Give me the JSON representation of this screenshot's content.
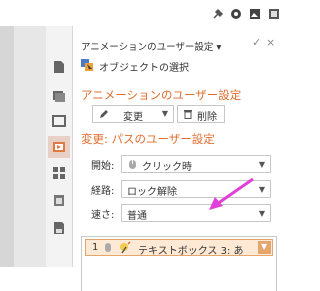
{
  "pane": {
    "title": "アニメーションのユーザー設定 ▾",
    "close_glyph": "×",
    "pin_glyph": "✓",
    "select_object_label": "オブジェクトの選択",
    "section_title": "アニメーションのユーザー設定",
    "change_button_label": "変更",
    "delete_button_label": "削除",
    "modify_section_title": "変更: パスのユーザー設定",
    "start_label": "開始:",
    "start_value": "クリック時",
    "path_label": "経路:",
    "path_value": "ロック解除",
    "speed_label": "速さ:",
    "speed_value": "普通"
  },
  "animation_list": [
    {
      "number": "1",
      "text": "テキストボックス 3: あ"
    }
  ],
  "colors": {
    "accent": "#e06c2d",
    "arrow": "#e040d8",
    "selected_item_bg": "#fde9d4"
  },
  "icons": {
    "toolbar": [
      "tool-icon",
      "logo-icon",
      "image-icon",
      "grid-icon"
    ],
    "sidebar": [
      "new-slide-icon",
      "slide-layout-icon",
      "outline-icon",
      "custom-animation-icon",
      "grid-layout-icon",
      "paste-icon",
      "save-icon"
    ]
  }
}
